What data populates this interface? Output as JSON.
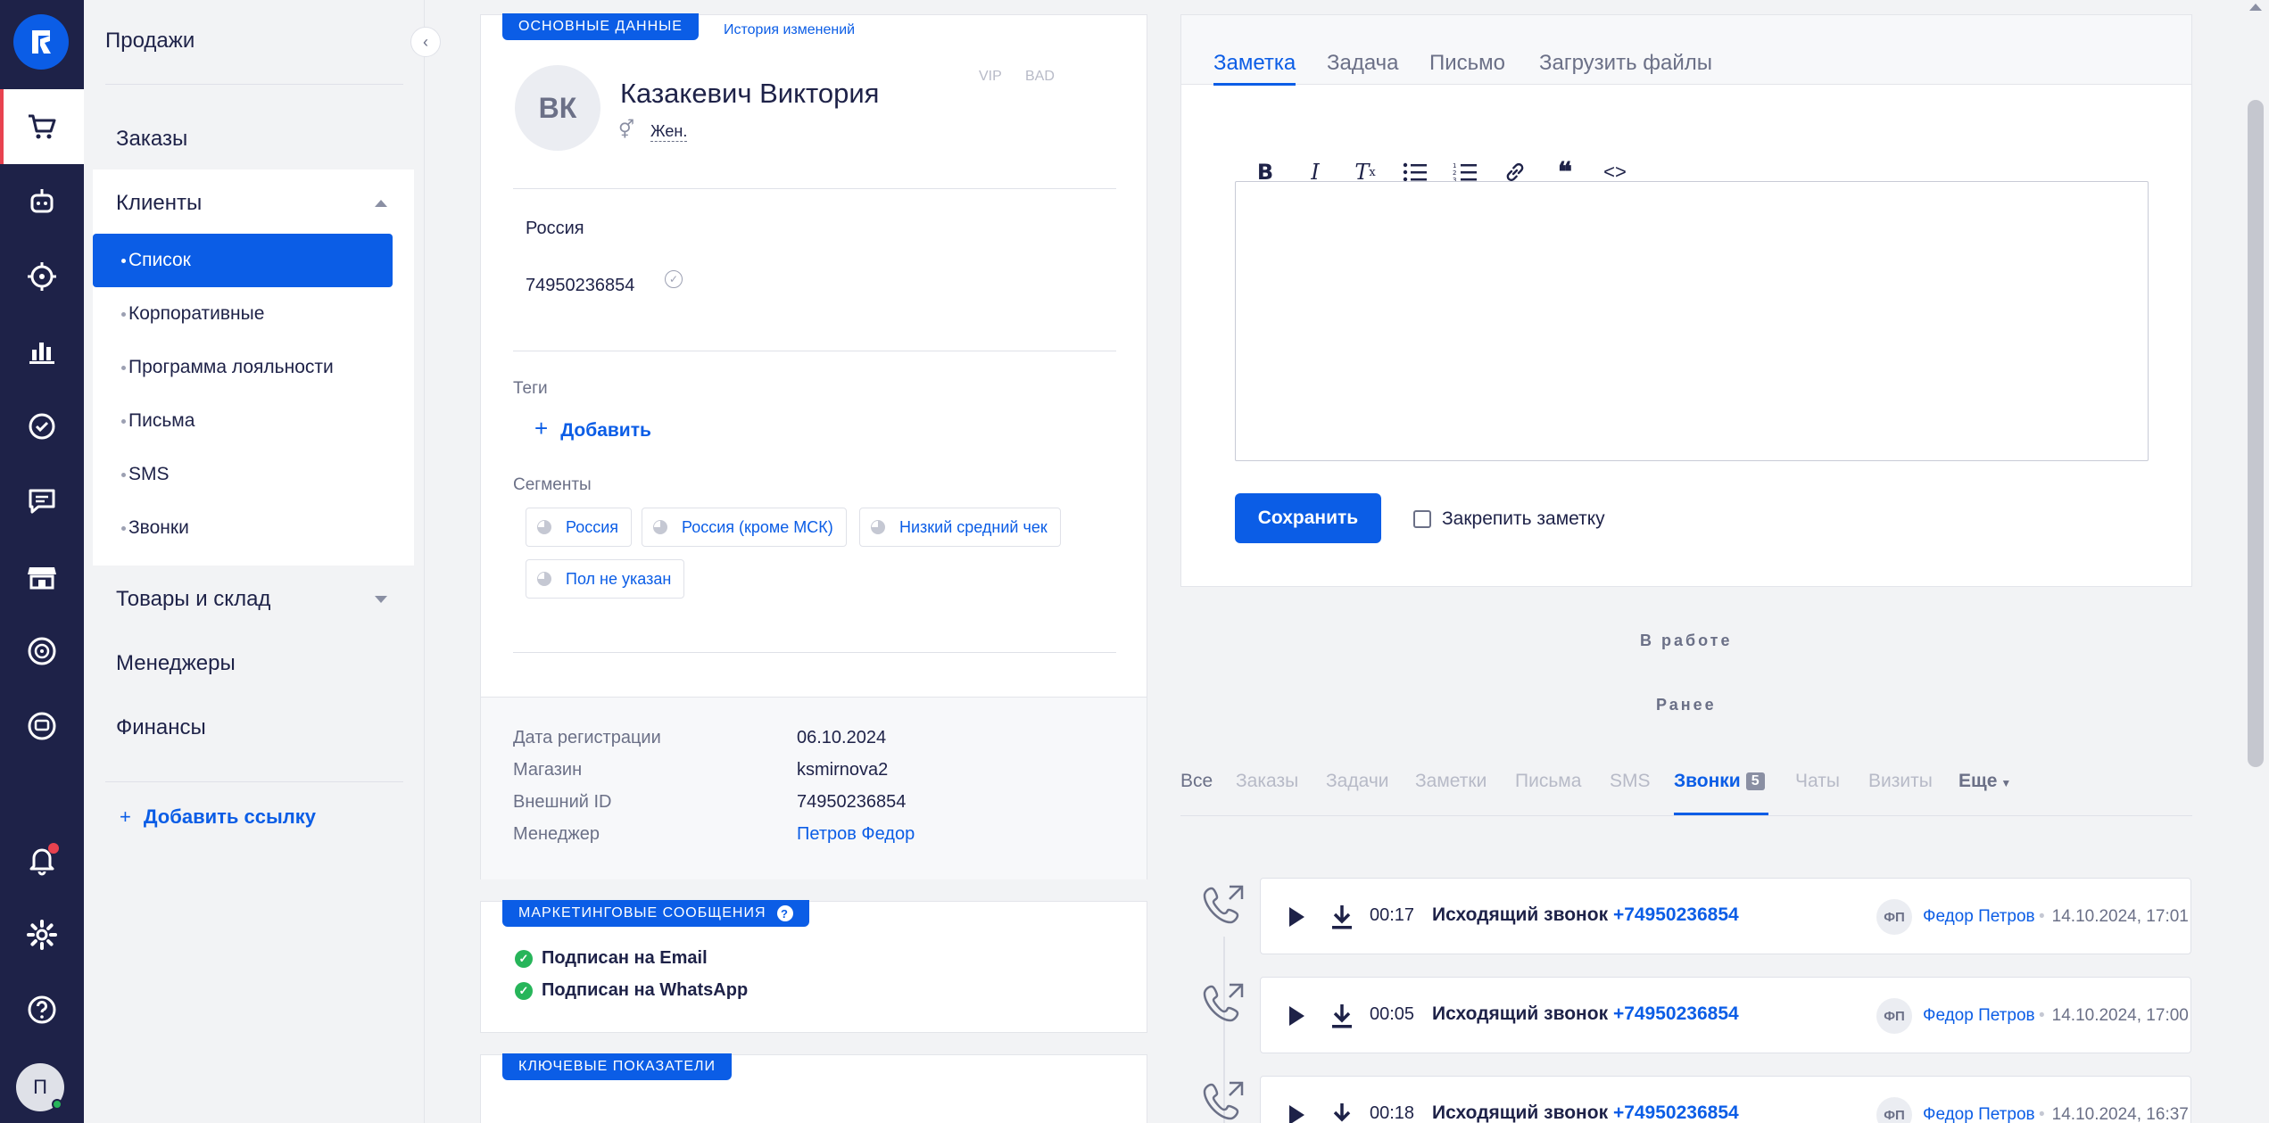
{
  "sidebar": {
    "title": "Продажи",
    "orders": "Заказы",
    "clients": {
      "label": "Клиенты",
      "items": [
        {
          "label": "Список",
          "active": true
        },
        {
          "label": "Корпоративные"
        },
        {
          "label": "Программа лояльности"
        },
        {
          "label": "Письма"
        },
        {
          "label": "SMS"
        },
        {
          "label": "Звонки"
        }
      ]
    },
    "goods": "Товары и склад",
    "managers": "Менеджеры",
    "finance": "Финансы",
    "add_link": "Добавить ссылку"
  },
  "customer": {
    "tab_main": "Основные данные",
    "tab_history": "История изменений",
    "initials": "ВК",
    "name": "Казакевич Виктория",
    "flags": [
      "VIP",
      "BAD"
    ],
    "gender": "Жен.",
    "country": "Россия",
    "phone": "74950236854",
    "tags_label": "Теги",
    "add_tag": "Добавить",
    "segments_label": "Сегменты",
    "segments": [
      "Россия",
      "Россия (кроме МСК)",
      "Низкий средний чек",
      "Пол не указан"
    ],
    "details": [
      {
        "label": "Дата регистрации",
        "value": "06.10.2024"
      },
      {
        "label": "Магазин",
        "value": "ksmirnova2"
      },
      {
        "label": "Внешний ID",
        "value": "74950236854"
      },
      {
        "label": "Менеджер",
        "value": "Петров Федор"
      }
    ]
  },
  "marketing": {
    "title": "Маркетинговые сообщения",
    "items": [
      "Подписан на Email",
      "Подписан на WhatsApp"
    ]
  },
  "kpi": {
    "title": "Ключевые показатели"
  },
  "note_panel": {
    "tabs": [
      "Заметка",
      "Задача",
      "Письмо",
      "Загрузить файлы"
    ],
    "active_tab": "Заметка",
    "save": "Сохранить",
    "pin": "Закрепить заметку"
  },
  "timeline": {
    "in_work": "В работе",
    "earlier": "Ранее",
    "filters": [
      "Все",
      "Заказы",
      "Задачи",
      "Заметки",
      "Письма",
      "SMS",
      "Звонки",
      "Чаты",
      "Визиты",
      "Еще"
    ],
    "calls_count": "5",
    "calls": [
      {
        "duration": "00:17",
        "type": "Исходящий звонок",
        "phone": "+74950236854",
        "manager_initials": "ФП",
        "manager": "Федор Петров",
        "datetime": "14.10.2024, 17:01"
      },
      {
        "duration": "00:05",
        "type": "Исходящий звонок",
        "phone": "+74950236854",
        "manager_initials": "ФП",
        "manager": "Федор Петров",
        "datetime": "14.10.2024, 17:00"
      },
      {
        "duration": "00:18",
        "type": "Исходящий звонок",
        "phone": "+74950236854",
        "manager_initials": "ФП",
        "manager": "Федор Петров",
        "datetime": "14.10.2024, 16:37"
      }
    ]
  },
  "user": {
    "initial": "П"
  },
  "colors": {
    "accent": "#0b5de6",
    "rail": "#1e2248",
    "alert": "#e8424f",
    "success": "#27b55a"
  }
}
